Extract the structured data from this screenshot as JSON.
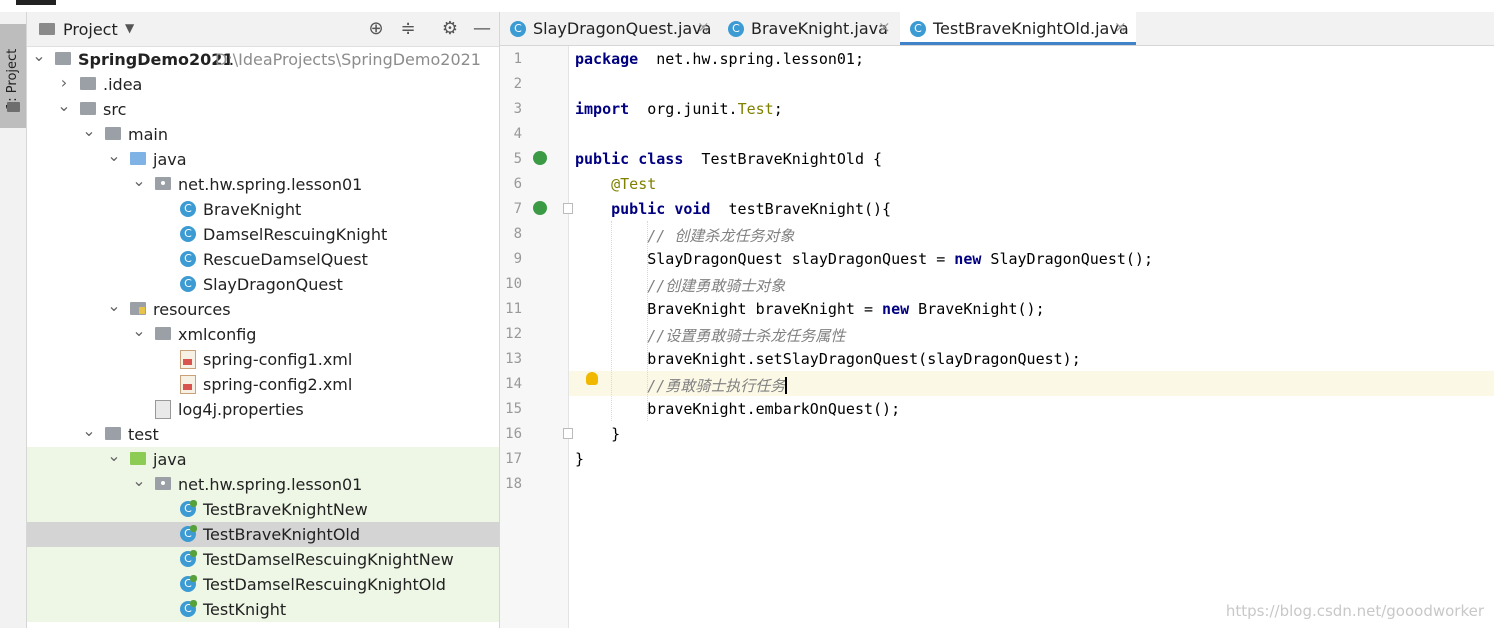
{
  "tool_window": {
    "label": "1: Project"
  },
  "project_panel": {
    "title": "Project",
    "tree": [
      {
        "label": "SpringDemo2021",
        "path": "D:\\IdeaProjects\\SpringDemo2021"
      },
      {
        "label": ".idea"
      },
      {
        "label": "src"
      },
      {
        "label": "main"
      },
      {
        "label": "java"
      },
      {
        "label": "net.hw.spring.lesson01"
      },
      {
        "label": "BraveKnight",
        "icon_letter": "C"
      },
      {
        "label": "DamselRescuingKnight",
        "icon_letter": "C"
      },
      {
        "label": "RescueDamselQuest",
        "icon_letter": "C"
      },
      {
        "label": "SlayDragonQuest",
        "icon_letter": "C"
      },
      {
        "label": "resources"
      },
      {
        "label": "xmlconfig"
      },
      {
        "label": "spring-config1.xml"
      },
      {
        "label": "spring-config2.xml"
      },
      {
        "label": "log4j.properties"
      },
      {
        "label": "test"
      },
      {
        "label": "java"
      },
      {
        "label": "net.hw.spring.lesson01"
      },
      {
        "label": "TestBraveKnightNew",
        "icon_letter": "C"
      },
      {
        "label": "TestBraveKnightOld",
        "icon_letter": "C"
      },
      {
        "label": "TestDamselRescuingKnightNew",
        "icon_letter": "C"
      },
      {
        "label": "TestDamselRescuingKnightOld",
        "icon_letter": "C"
      },
      {
        "label": "TestKnight",
        "icon_letter": "C"
      }
    ]
  },
  "editor_tabs": [
    {
      "label": "SlayDragonQuest.java",
      "close": "×",
      "icon_letter": "C"
    },
    {
      "label": "BraveKnight.java",
      "close": "×",
      "icon_letter": "C"
    },
    {
      "label": "TestBraveKnightOld.java",
      "close": "×",
      "icon_letter": "C",
      "active": true
    }
  ],
  "editor": {
    "current_line": 14,
    "lines": [
      {
        "n": "1",
        "parts": [
          [
            "kw",
            "package"
          ],
          [
            "",
            "  net.hw.spring.lesson01;"
          ]
        ]
      },
      {
        "n": "2",
        "parts": []
      },
      {
        "n": "3",
        "parts": [
          [
            "kw",
            "import"
          ],
          [
            "",
            "  org.junit."
          ],
          [
            "ann",
            "Test"
          ],
          [
            "",
            ";"
          ]
        ]
      },
      {
        "n": "4",
        "parts": []
      },
      {
        "n": "5",
        "parts": [
          [
            "kw",
            "public class"
          ],
          [
            "",
            "  TestBraveKnightOld {"
          ]
        ]
      },
      {
        "n": "6",
        "parts": [
          [
            "",
            "    "
          ],
          [
            "ann",
            "@Test"
          ]
        ]
      },
      {
        "n": "7",
        "parts": [
          [
            "",
            "    "
          ],
          [
            "kw",
            "public void"
          ],
          [
            "",
            "  testBraveKnight(){"
          ]
        ]
      },
      {
        "n": "8",
        "parts": [
          [
            "",
            "        "
          ],
          [
            "cm",
            "// 创建杀龙任务对象"
          ]
        ]
      },
      {
        "n": "9",
        "parts": [
          [
            "",
            "        SlayDragonQuest slayDragonQuest = "
          ],
          [
            "kw",
            "new"
          ],
          [
            "",
            " SlayDragonQuest();"
          ]
        ]
      },
      {
        "n": "10",
        "parts": [
          [
            "",
            "        "
          ],
          [
            "cm",
            "//创建勇敢骑士对象"
          ]
        ]
      },
      {
        "n": "11",
        "parts": [
          [
            "",
            "        BraveKnight braveKnight = "
          ],
          [
            "kw",
            "new"
          ],
          [
            "",
            " BraveKnight();"
          ]
        ]
      },
      {
        "n": "12",
        "parts": [
          [
            "",
            "        "
          ],
          [
            "cm",
            "//设置勇敢骑士杀龙任务属性"
          ]
        ]
      },
      {
        "n": "13",
        "parts": [
          [
            "",
            "        braveKnight.setSlayDragonQuest(slayDragonQuest);"
          ]
        ]
      },
      {
        "n": "14",
        "parts": [
          [
            "",
            "        "
          ],
          [
            "cm",
            "//勇敢骑士执行任务"
          ]
        ]
      },
      {
        "n": "15",
        "parts": [
          [
            "",
            "        braveKnight.embarkOnQuest();"
          ]
        ]
      },
      {
        "n": "16",
        "parts": [
          [
            "",
            "    }"
          ]
        ]
      },
      {
        "n": "17",
        "parts": [
          [
            "",
            "}"
          ]
        ]
      },
      {
        "n": "18",
        "parts": []
      }
    ]
  },
  "watermark": "https://blog.csdn.net/gooodworker",
  "colors": {
    "keyword": "#000080",
    "annotation": "#808000",
    "comment": "#808080",
    "accent": "#4083c9",
    "test_highlight": "#eef7e6"
  }
}
